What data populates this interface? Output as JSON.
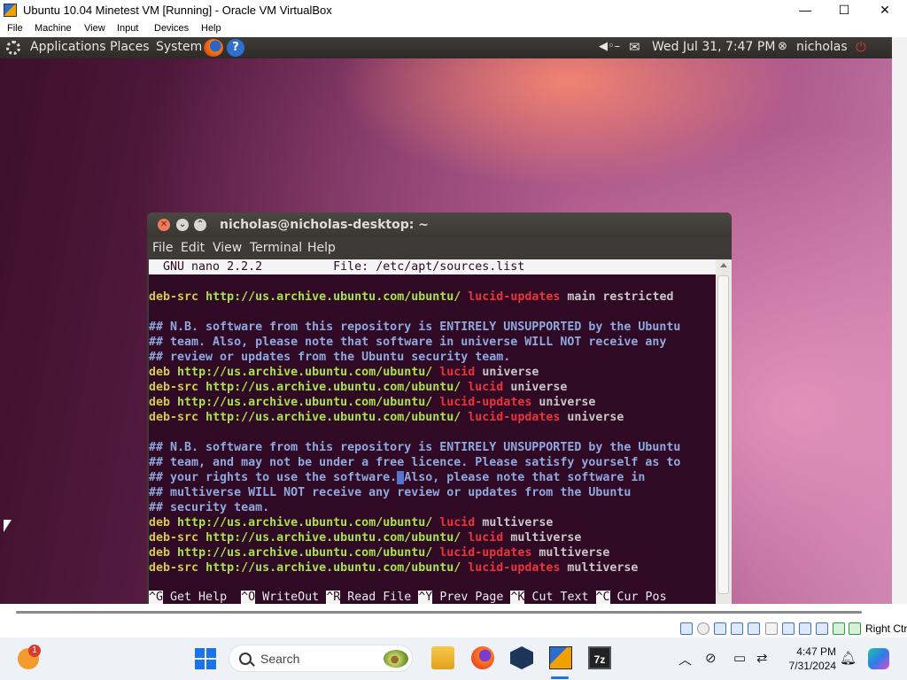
{
  "vbox": {
    "title": "Ubuntu 10.04 Minetest VM [Running] - Oracle VM VirtualBox",
    "menu": [
      "File",
      "Machine",
      "View",
      "Input",
      "Devices",
      "Help"
    ],
    "window_buttons": {
      "minimize": "—",
      "maximize": "☐",
      "close": "✕"
    },
    "host_key": "Right Ctrl"
  },
  "gnome_panel": {
    "menus": [
      "Applications",
      "Places",
      "System"
    ],
    "datetime": "Wed Jul 31,  7:47 PM",
    "user": "nicholas"
  },
  "terminal": {
    "title": "nicholas@nicholas-desktop: ~",
    "menu": [
      "File",
      "Edit",
      "View",
      "Terminal",
      "Help"
    ],
    "nano_version": "GNU nano 2.2.2",
    "nano_file": "File: /etc/apt/sources.list",
    "lines": [
      {
        "kind": "src",
        "kw": "deb-src",
        "url": "http://us.archive.ubuntu.com/ubuntu/",
        "rel": "lucid-updates",
        "comp": "main restricted"
      },
      {
        "kind": "blank"
      },
      {
        "kind": "comment",
        "text": "## N.B. software from this repository is ENTIRELY UNSUPPORTED by the Ubuntu"
      },
      {
        "kind": "comment",
        "text": "## team. Also, please note that software in universe WILL NOT receive any"
      },
      {
        "kind": "comment",
        "text": "## review or updates from the Ubuntu security team."
      },
      {
        "kind": "src",
        "kw": "deb",
        "url": "http://us.archive.ubuntu.com/ubuntu/",
        "rel": "lucid",
        "comp": "universe"
      },
      {
        "kind": "src",
        "kw": "deb-src",
        "url": "http://us.archive.ubuntu.com/ubuntu/",
        "rel": "lucid",
        "comp": "universe"
      },
      {
        "kind": "src",
        "kw": "deb",
        "url": "http://us.archive.ubuntu.com/ubuntu/",
        "rel": "lucid-updates",
        "comp": "universe"
      },
      {
        "kind": "src",
        "kw": "deb-src",
        "url": "http://us.archive.ubuntu.com/ubuntu/",
        "rel": "lucid-updates",
        "comp": "universe"
      },
      {
        "kind": "blank"
      },
      {
        "kind": "comment",
        "text": "## N.B. software from this repository is ENTIRELY UNSUPPORTED by the Ubuntu"
      },
      {
        "kind": "comment",
        "text": "## team, and may not be under a free licence. Please satisfy yourself as to"
      },
      {
        "kind": "cursor",
        "before": "## your rights to use the software.",
        "cursor": " ",
        "after": "Also, please note that software in"
      },
      {
        "kind": "comment",
        "text": "## multiverse WILL NOT receive any review or updates from the Ubuntu"
      },
      {
        "kind": "comment",
        "text": "## security team."
      },
      {
        "kind": "src",
        "kw": "deb",
        "url": "http://us.archive.ubuntu.com/ubuntu/",
        "rel": "lucid",
        "comp": "multiverse"
      },
      {
        "kind": "src",
        "kw": "deb-src",
        "url": "http://us.archive.ubuntu.com/ubuntu/",
        "rel": "lucid",
        "comp": "multiverse"
      },
      {
        "kind": "src",
        "kw": "deb",
        "url": "http://us.archive.ubuntu.com/ubuntu/",
        "rel": "lucid-updates",
        "comp": "multiverse"
      },
      {
        "kind": "src",
        "kw": "deb-src",
        "url": "http://us.archive.ubuntu.com/ubuntu/",
        "rel": "lucid-updates",
        "comp": "multiverse"
      },
      {
        "kind": "blank"
      }
    ],
    "shortcuts": [
      {
        "key": "^G",
        "label": "Get Help"
      },
      {
        "key": "^O",
        "label": "WriteOut"
      },
      {
        "key": "^R",
        "label": "Read File"
      },
      {
        "key": "^Y",
        "label": "Prev Page"
      },
      {
        "key": "^K",
        "label": "Cut Text"
      },
      {
        "key": "^C",
        "label": "Cur Pos"
      }
    ],
    "colors": {
      "background": "#300a24",
      "keyword": "#d7c84a",
      "url": "#a8e24a",
      "release": "#e8343a",
      "component": "#c7c7c7",
      "comment": "#8fa8e0"
    }
  },
  "taskbar": {
    "search_placeholder": "Search",
    "notification_count": "1",
    "time": "4:47 PM",
    "date": "7/31/2024"
  }
}
